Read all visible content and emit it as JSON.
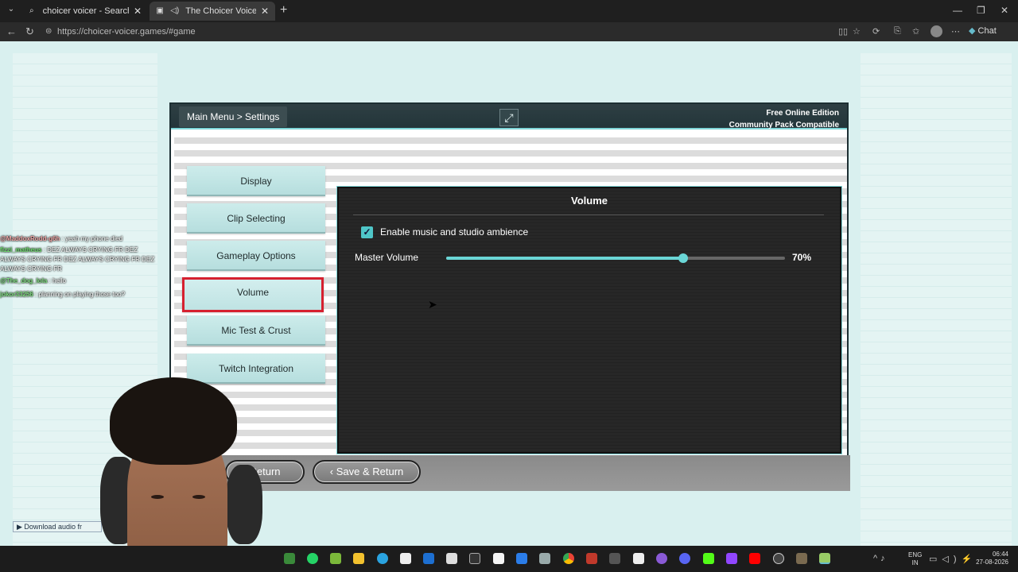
{
  "browser": {
    "tabs": [
      {
        "title": "choicer voicer - Search",
        "icon": "search-icon"
      },
      {
        "title": "The Choicer Voicer - Free Onli",
        "icon": "game-icon",
        "active": true
      }
    ],
    "new_tab": "+",
    "url": "https://choicer-voicer.games/#game",
    "chat_label": "Chat",
    "window": {
      "minimize": "—",
      "restore": "❐",
      "close": "✕"
    }
  },
  "game": {
    "breadcrumb": "Main Menu > Settings",
    "edition_line1": "Free Online Edition",
    "edition_line2": "Community Pack Compatible",
    "fullscreen_icon": "⤢",
    "menu": [
      {
        "label": "Display",
        "active": false
      },
      {
        "label": "Clip Selecting",
        "active": false
      },
      {
        "label": "Gameplay Options",
        "active": false
      },
      {
        "label": "Volume",
        "active": true
      },
      {
        "label": "Mic Test & Crust",
        "active": false
      },
      {
        "label": "Twitch Integration",
        "active": false
      }
    ],
    "panel": {
      "title": "Volume",
      "checkbox_label": "Enable music and studio ambience",
      "checkbox_checked": true,
      "master_volume_label": "Master Volume",
      "master_volume_value": "70%",
      "master_volume_level": 0.7
    },
    "buttons": {
      "return": "Return",
      "save_return": "Save & Return"
    }
  },
  "chat_overlay": [
    {
      "user": "@MaddoxRodd-g6h",
      "text": ": yeah my phone died",
      "color": "#f2a7a7"
    },
    {
      "user": "fizzi_matheus",
      "text": ": DEZ ALWAYS CRYING FR DEZ ALWAYS CRYING FR DEZ ALWAYS CRYING FR DEZ ALWAYS CRYING FR",
      "color": "#6ee06e"
    },
    {
      "user": "@The_dog_lola",
      "text": ": hello",
      "color": "#7fe07f"
    },
    {
      "user": "jokor33256",
      "text": ": planning on playing those too?",
      "color": "#7fe07f"
    }
  ],
  "download_link": "Download audio fr",
  "taskbar": {
    "lang_line1": "ENG",
    "lang_line2": "IN",
    "time": "06:44",
    "date": "27-08-2026"
  },
  "colors": {
    "accent": "#6ad6d6",
    "active_outline": "#d6202f"
  }
}
